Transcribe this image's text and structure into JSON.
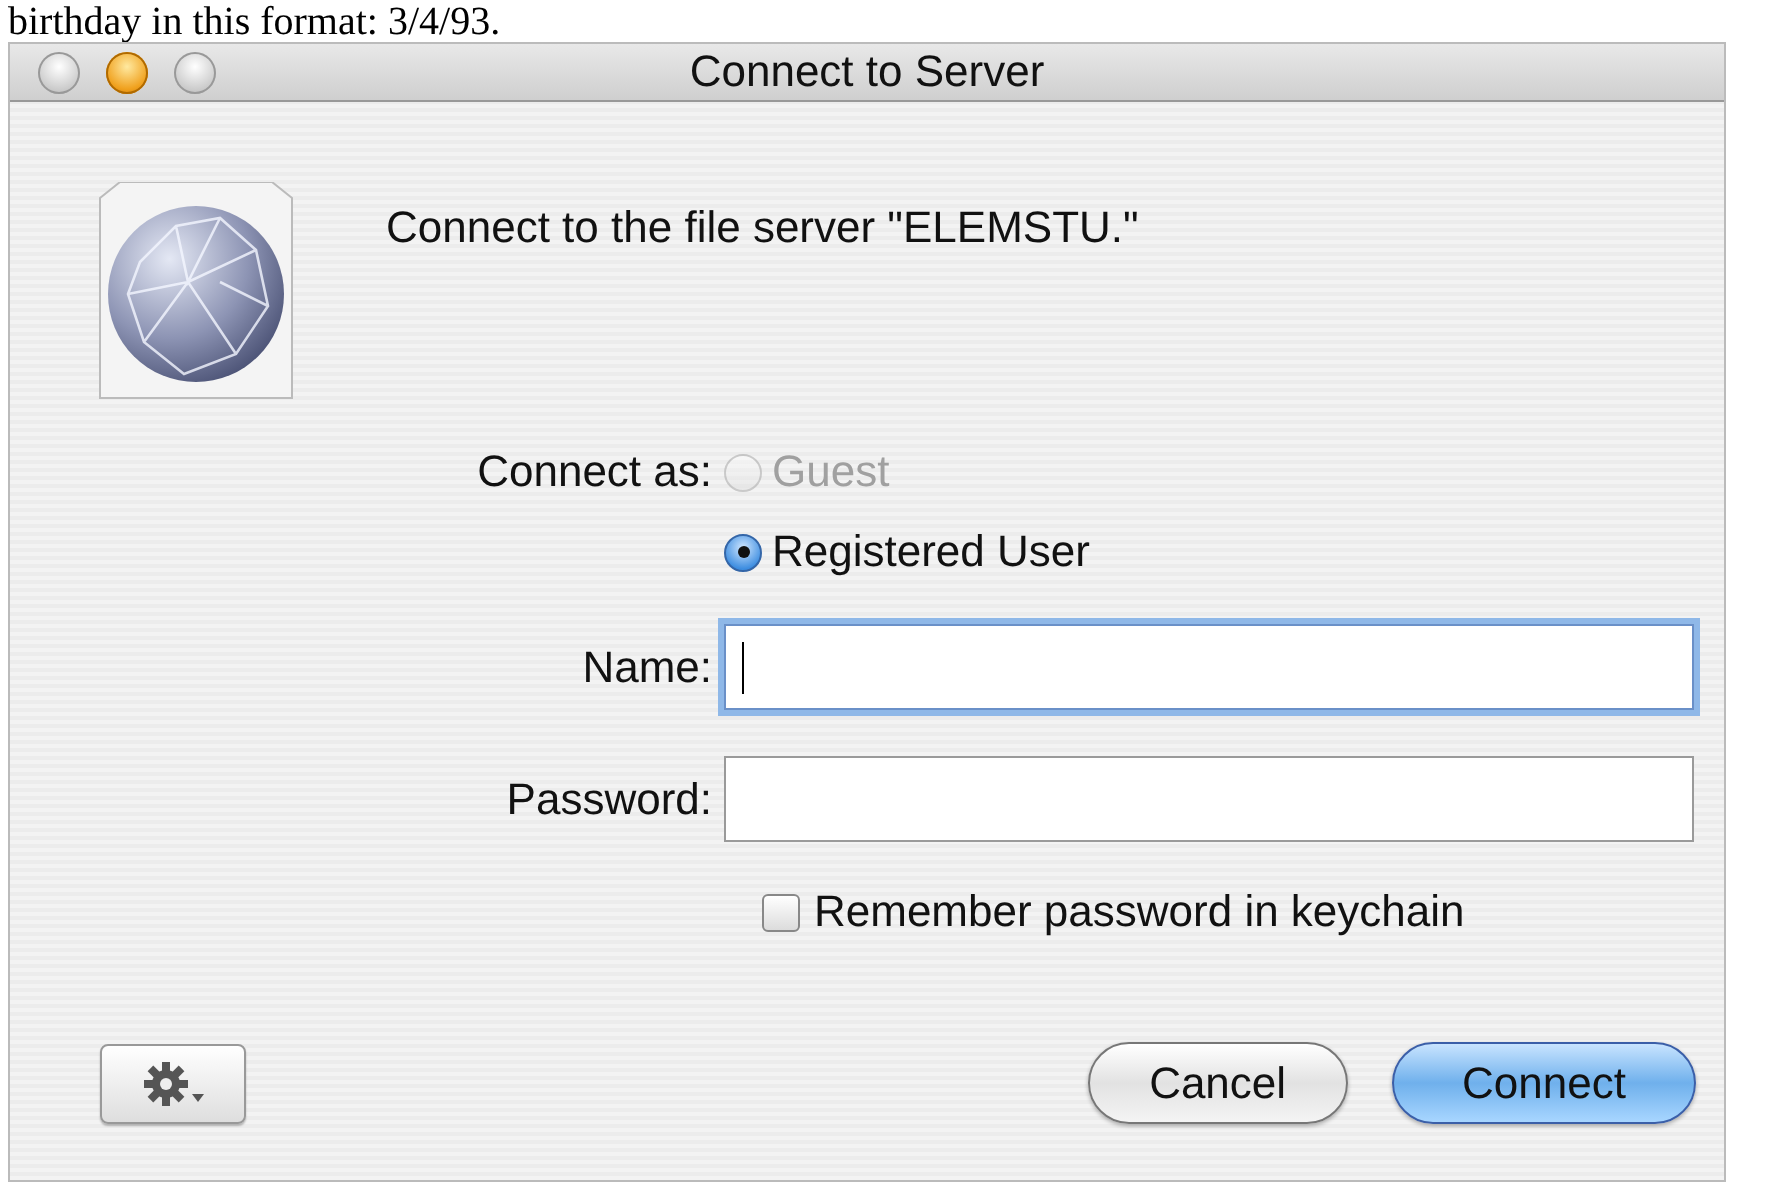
{
  "background_text": "birthday in this format: 3/4/93.",
  "window": {
    "title": "Connect to Server"
  },
  "message": "Connect to the file server \"ELEMSTU.\"",
  "connect_as": {
    "label": "Connect as:",
    "options": [
      {
        "label": "Guest",
        "selected": false,
        "disabled": true
      },
      {
        "label": "Registered User",
        "selected": true,
        "disabled": false
      }
    ]
  },
  "fields": [
    {
      "label": "Name:",
      "focused": true
    },
    {
      "label": "Password:",
      "focused": false
    }
  ],
  "remember_keychain": {
    "label": "Remember password in keychain",
    "checked": false
  },
  "buttons": [
    {
      "label": "Cancel",
      "default": false
    },
    {
      "label": "Connect",
      "default": true
    }
  ]
}
